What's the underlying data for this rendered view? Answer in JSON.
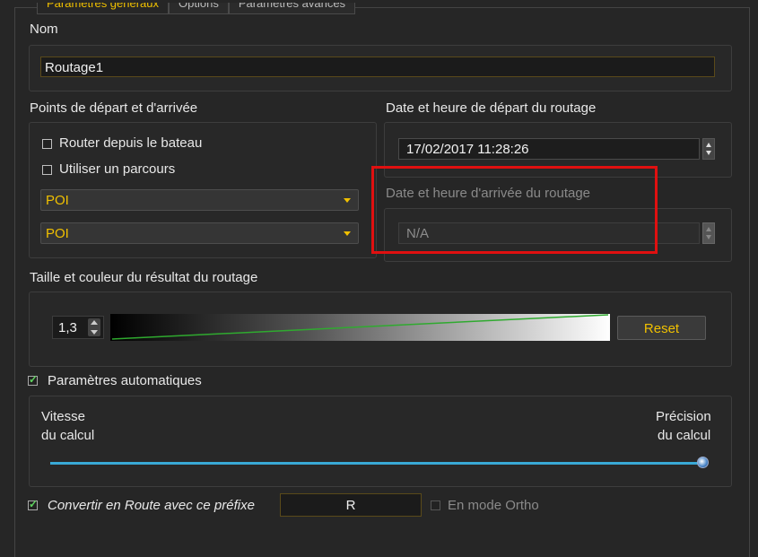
{
  "tabs": [
    "Paramètres généraux",
    "Options",
    "Paramètres avancés"
  ],
  "name": {
    "label": "Nom",
    "value": "Routage1"
  },
  "points": {
    "label": "Points de départ et d'arrivée",
    "route_from_boat": "Router depuis le bateau",
    "use_course": "Utiliser un parcours",
    "start_select": "POI",
    "end_select": "POI"
  },
  "departure": {
    "label": "Date et heure de départ du routage",
    "value": "17/02/2017 11:28:26"
  },
  "arrival": {
    "label": "Date et heure d'arrivée du routage",
    "value": "N/A"
  },
  "result_style": {
    "label": "Taille et couleur du résultat du routage",
    "size": "1,3",
    "reset_label": "Reset"
  },
  "auto_params": {
    "label": "Paramètres automatiques",
    "checked": true,
    "left_label_1": "Vitesse",
    "left_label_2": "du calcul",
    "right_label_1": "Précision",
    "right_label_2": "du calcul",
    "slider_value": 1.0
  },
  "convert": {
    "label": "Convertir en Route avec ce préfixe",
    "checked": true,
    "prefix": "R",
    "ortho_label": "En mode Ortho",
    "ortho_checked": false
  },
  "colors": {
    "accent": "#f0c000",
    "highlight": "#e01010",
    "slider": "#39a9d6",
    "line": "#2faa2f"
  }
}
